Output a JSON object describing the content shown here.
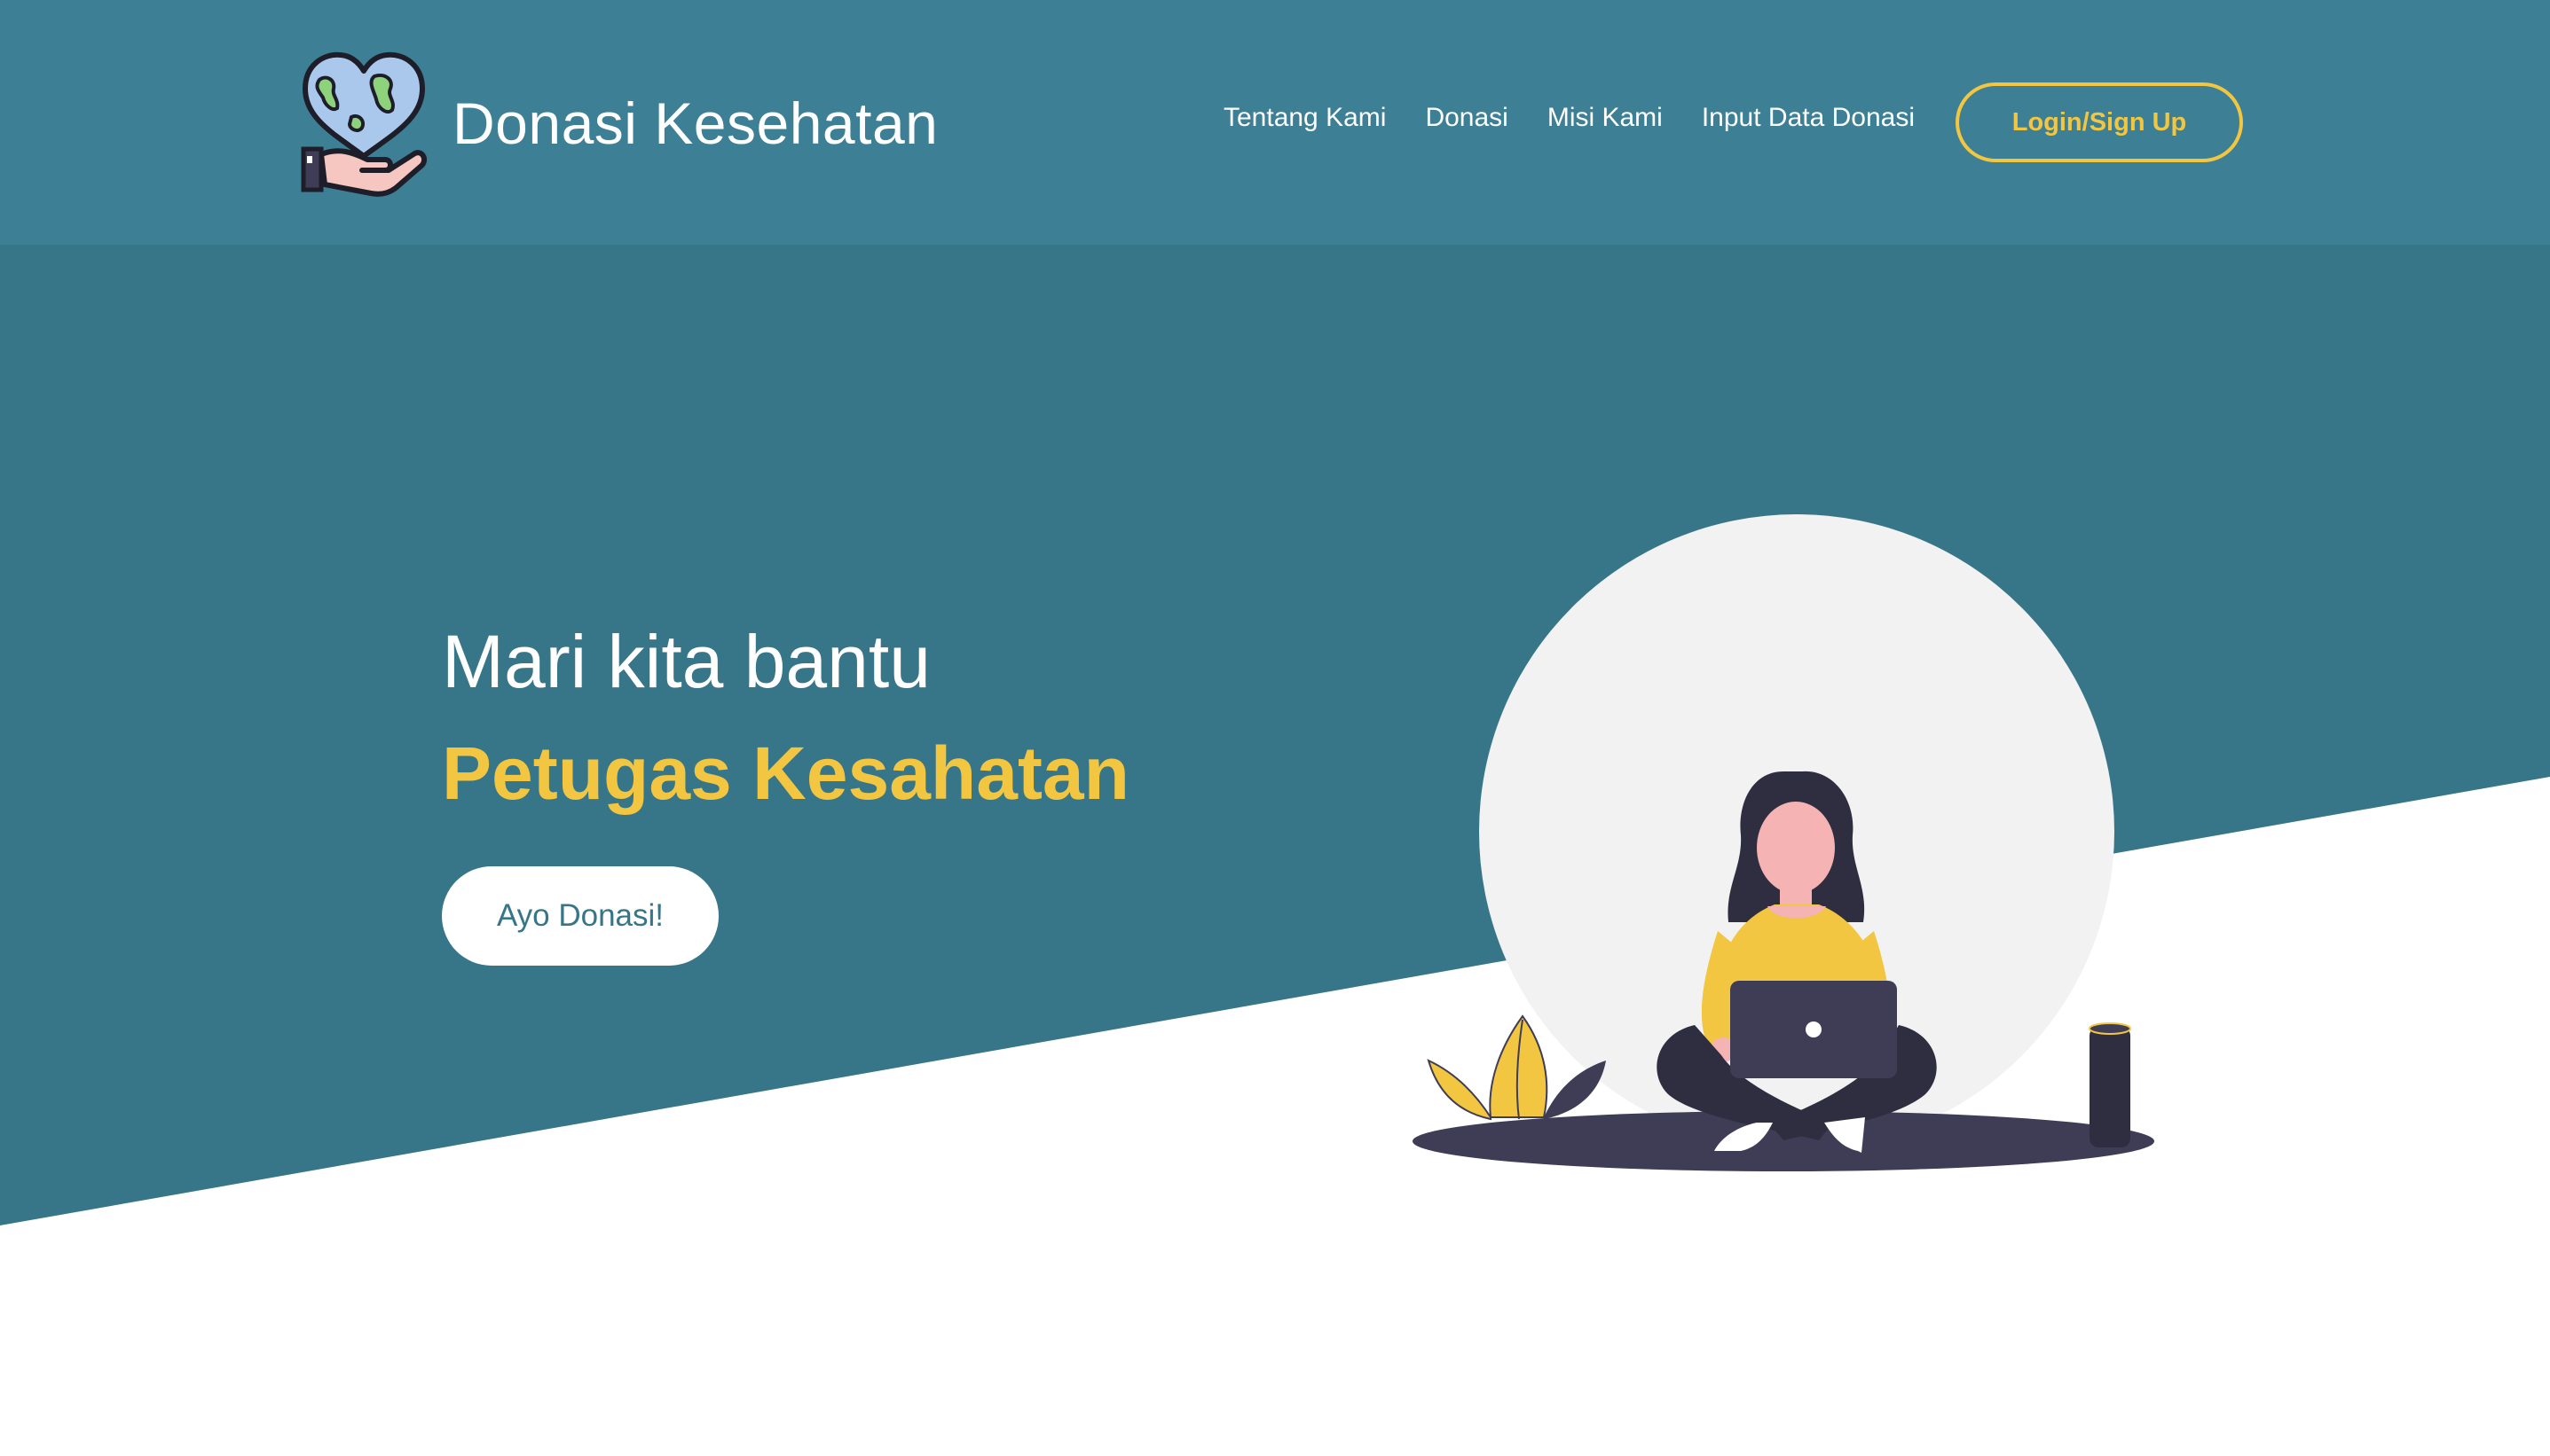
{
  "header": {
    "brand_name": "Donasi Kesehatan",
    "logo_icon": "heart-globe-hand-icon",
    "nav": [
      {
        "label": "Tentang Kami"
      },
      {
        "label": "Donasi"
      },
      {
        "label": "Misi Kami"
      },
      {
        "label": "Input Data Donasi"
      }
    ],
    "login_label": "Login/Sign Up"
  },
  "hero": {
    "line1": "Mari kita bantu",
    "line2": "Petugas Kesahatan",
    "cta_label": "Ayo Donasi!",
    "illustration_icon": "woman-with-laptop-illustration"
  },
  "colors": {
    "header_bg": "#3d8096",
    "hero_bg": "#377688",
    "accent_yellow": "#f2c641",
    "white": "#ffffff",
    "dark_navy": "#3f3d56",
    "circle_gray": "#f2f2f2"
  }
}
